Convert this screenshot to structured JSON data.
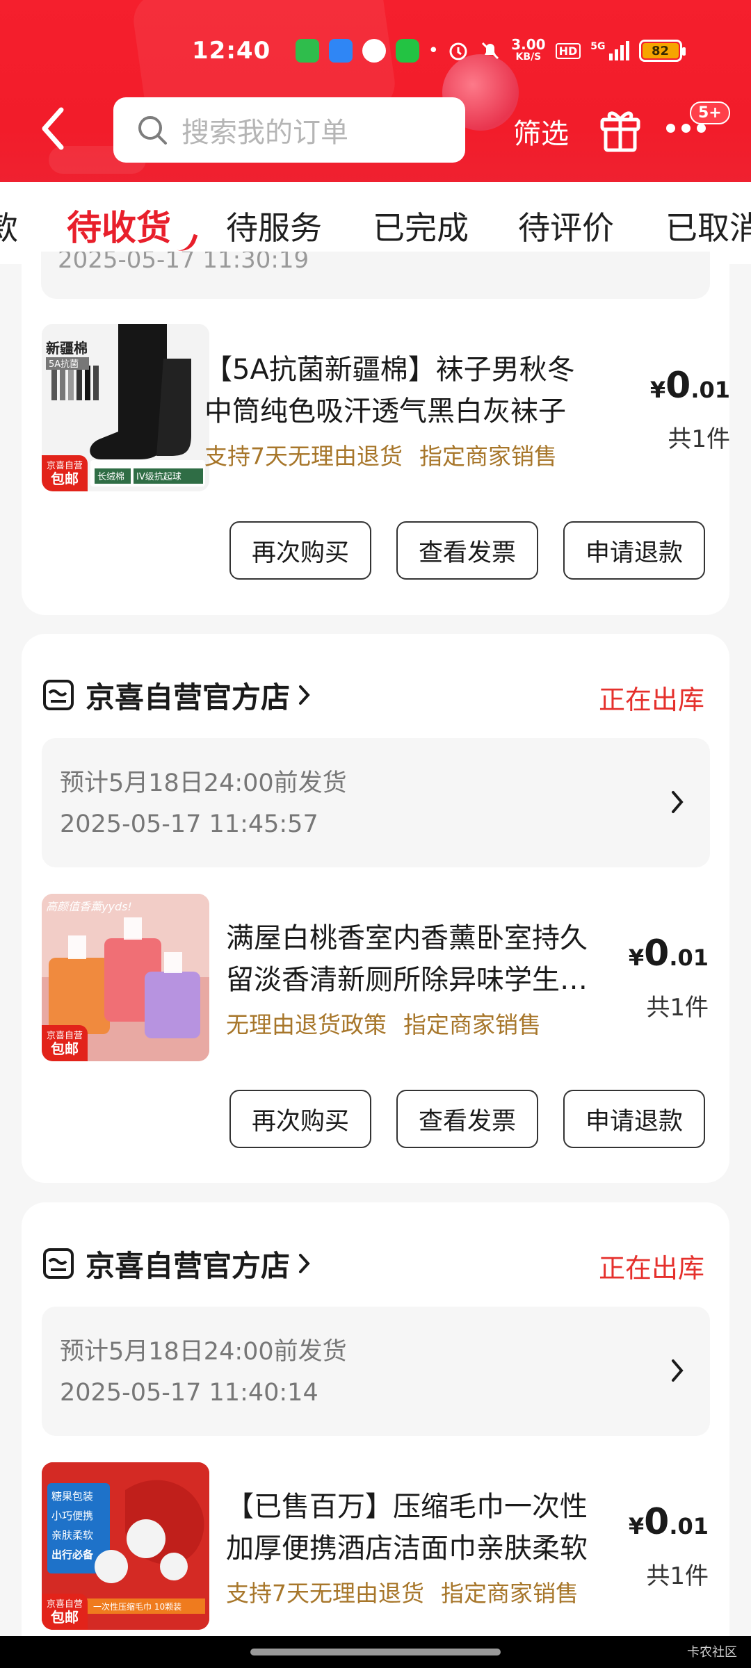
{
  "status_bar": {
    "time": "12:40",
    "net_speed_value": "3.00",
    "net_speed_unit": "KB/S",
    "hd_label": "HD",
    "signal_label": "5G",
    "battery": "82"
  },
  "header": {
    "search_placeholder": "搜索我的订单",
    "filter_label": "筛选",
    "more_badge": "5+"
  },
  "tabs": [
    "款",
    "待收货",
    "待服务",
    "已完成",
    "待评价",
    "已取消"
  ],
  "active_tab": "待收货",
  "partial_timestamp": "2025-05-17 11:30:19",
  "orders": [
    {
      "product_title": "【5A抗菌新疆棉】袜子男秋冬中筒纯色吸汗透气黑白灰袜子",
      "tags": [
        "支持7天无理由退货",
        "指定商家销售"
      ],
      "price_currency": "¥",
      "price_int": "0",
      "price_dec": ".01",
      "quantity": "共1件",
      "buttons": [
        "再次购买",
        "查看发票",
        "申请退款"
      ],
      "thumb_text": {
        "brand": "新疆棉",
        "sub": "5A抗菌",
        "tag_top": "京喜自营",
        "tag_bottom": "包邮",
        "b1": "长绒棉",
        "b2": "IV级抗起球",
        "b3": "5A抗菌"
      }
    },
    {
      "shop_name": "京喜自营官方店",
      "shop_status": "正在出库",
      "ship_estimate": "预计5月18日24:00前发货",
      "order_time": "2025-05-17 11:45:57",
      "product_title": "满屋白桃香室内香薰卧室持久留淡香清新厕所除异味学生宿舍",
      "tags": [
        "无理由退货政策",
        "指定商家销售"
      ],
      "price_currency": "¥",
      "price_int": "0",
      "price_dec": ".01",
      "quantity": "共1件",
      "buttons": [
        "再次购买",
        "查看发票",
        "申请退款"
      ],
      "thumb_text": {
        "top": "高颜值香薰yyds!",
        "tag_top": "京喜自营",
        "tag_bottom": "包邮"
      }
    },
    {
      "shop_name": "京喜自营官方店",
      "shop_status": "正在出库",
      "ship_estimate": "预计5月18日24:00前发货",
      "order_time": "2025-05-17 11:40:14",
      "product_title": "【已售百万】压缩毛巾一次性加厚便携酒店洁面巾亲肤柔软",
      "tags": [
        "支持7天无理由退货",
        "指定商家销售"
      ],
      "price_currency": "¥",
      "price_int": "0",
      "price_dec": ".01",
      "quantity": "共1件",
      "thumb_text": {
        "l1": "糖果包装",
        "l2": "小巧便携",
        "l3": "亲肤柔软",
        "l4": "出行必备",
        "tag_top": "京喜自营",
        "tag_bottom": "包邮",
        "banner": "一次性压缩毛巾 10颗装"
      }
    }
  ],
  "watermark": "卡农社区",
  "colors": {
    "header_red": "#f21c2a",
    "accent_red": "#e81f2b",
    "tag_gold": "#a7762a",
    "shop_status_red": "#e5302c"
  }
}
